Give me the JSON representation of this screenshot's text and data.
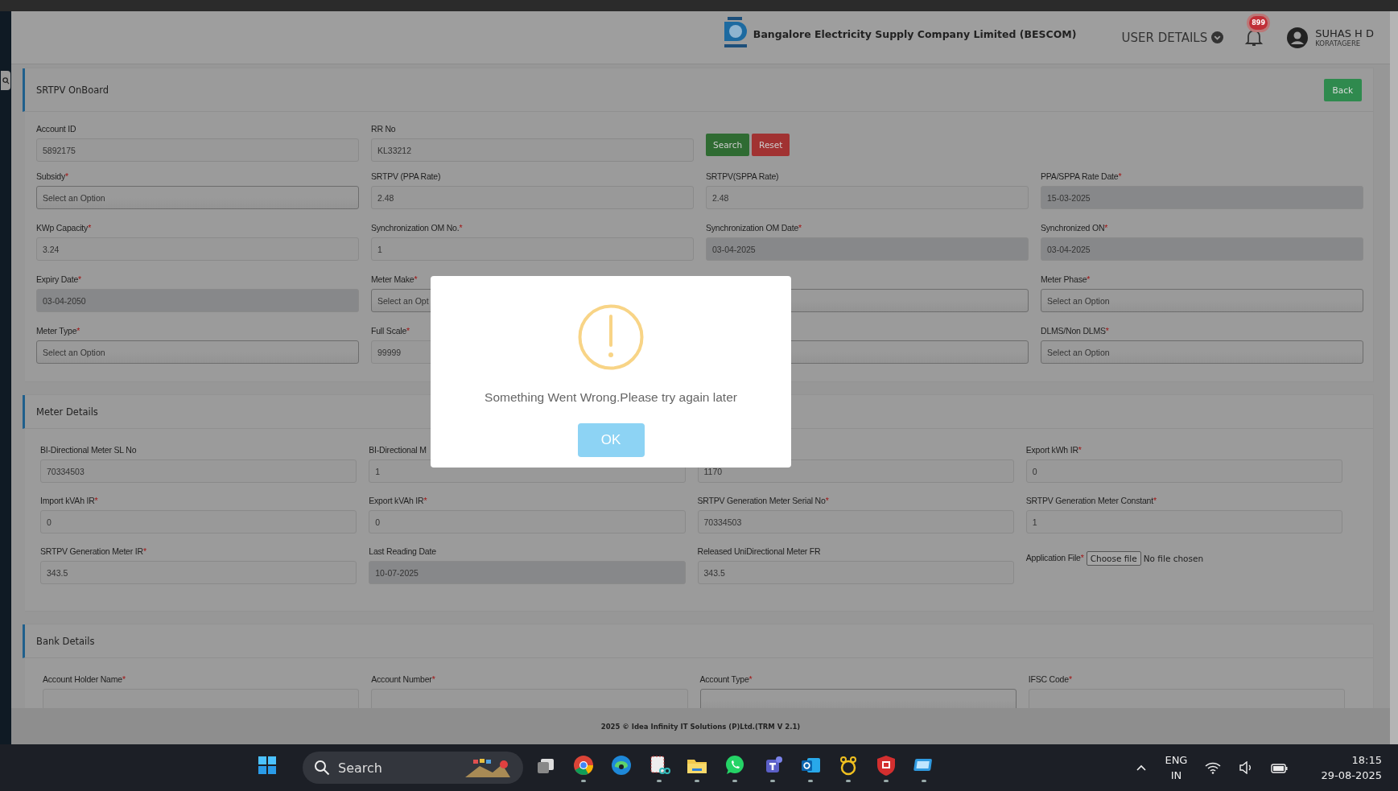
{
  "header": {
    "company": "Bangalore Electricity Supply Company Limited (BESCOM)",
    "user_menu": "USER DETAILS",
    "notifications": "899",
    "user_name": "SUHAS H D",
    "user_location": "KORATAGERE"
  },
  "page": {
    "title": "SRTPV OnBoard",
    "back": "Back"
  },
  "search_form": {
    "fields": [
      {
        "label": "Account ID",
        "kind": "text",
        "value": "5892175"
      },
      {
        "label": "RR No",
        "kind": "text",
        "value": "KL33212"
      }
    ],
    "buttons": [
      {
        "label": "Search",
        "kind": "primary"
      },
      {
        "label": "Reset",
        "kind": "danger"
      }
    ]
  },
  "details": {
    "fields": [
      {
        "label": "Subsidy",
        "required_mark": "*",
        "kind": "select",
        "placeholder": "Select an Option"
      },
      {
        "label": "SRTPV (PPA Rate)",
        "kind": "text",
        "value": "2.48"
      },
      {
        "label": "SRTPV(SPPA Rate)",
        "kind": "text",
        "value": "2.48"
      },
      {
        "label": "PPA/SPPA Rate Date",
        "required_mark": "*",
        "kind": "date",
        "value": "15-03-2025"
      },
      {
        "label": "KWp Capacity",
        "required_mark": "*",
        "kind": "text",
        "value": "3.24"
      },
      {
        "label": "Synchronization OM No.",
        "required_mark": "*",
        "kind": "text",
        "value": "1"
      },
      {
        "label": "Synchronization OM Date",
        "required_mark": "*",
        "kind": "date",
        "value": "03-04-2025"
      },
      {
        "label": "Synchronized ON",
        "required_mark": "*",
        "kind": "date",
        "value": "03-04-2025"
      },
      {
        "label": "Expiry Date",
        "required_mark": "*",
        "kind": "date",
        "value": "03-04-2050"
      },
      {
        "label": "Meter Make",
        "required_mark": "*",
        "kind": "select",
        "placeholder": "Select an Opt"
      },
      {
        "kind": "select"
      },
      {
        "label": "Meter Phase",
        "required_mark": "*",
        "kind": "select",
        "placeholder": "Select an Option"
      },
      {
        "label": "Meter Type",
        "required_mark": "*",
        "kind": "select",
        "placeholder": "Select an Option"
      },
      {
        "label": "Full Scale",
        "required_mark": "*",
        "kind": "text",
        "value": "99999"
      },
      {
        "kind": "select"
      },
      {
        "label": "DLMS/Non DLMS",
        "required_mark": "*",
        "kind": "select",
        "placeholder": "Select an Option"
      }
    ]
  },
  "meter_details": {
    "title": "Meter Details",
    "fields": [
      {
        "label": "BI-Directional Meter SL No",
        "kind": "text",
        "value": "70334503"
      },
      {
        "label": "BI-Directional M",
        "kind": "text",
        "value": "1"
      },
      {
        "kind": "text",
        "value": "1170"
      },
      {
        "label": "Export kWh IR",
        "required_mark": "*",
        "kind": "text",
        "value": "0"
      },
      {
        "label": "Import kVAh IR",
        "required_mark": "*",
        "kind": "text",
        "value": "0"
      },
      {
        "label": "Export kVAh IR",
        "required_mark": "*",
        "kind": "text",
        "value": "0"
      },
      {
        "label": "SRTPV Generation Meter Serial No",
        "required_mark": "*",
        "kind": "text",
        "value": "70334503"
      },
      {
        "label": "SRTPV Generation Meter Constant",
        "required_mark": "*",
        "kind": "text",
        "value": "1"
      },
      {
        "label": "SRTPV Generation Meter IR",
        "required_mark": "*",
        "kind": "text",
        "value": "343.5"
      },
      {
        "label": "Last Reading Date",
        "kind": "date",
        "value": "10-07-2025"
      },
      {
        "label": "Released UniDirectional Meter FR",
        "kind": "text",
        "value": "343.5"
      },
      {
        "label": "Application File",
        "required_mark": "*",
        "kind": "file",
        "button": "Choose file",
        "status": "No file chosen"
      }
    ]
  },
  "bank_details": {
    "title": "Bank Details",
    "fields": [
      {
        "label": "Account Holder Name",
        "required_mark": "*",
        "kind": "text"
      },
      {
        "label": "Account Number",
        "required_mark": "*",
        "kind": "text"
      },
      {
        "label": "Account Type",
        "required_mark": "*",
        "kind": "select"
      },
      {
        "label": "IFSC Code",
        "required_mark": "*",
        "kind": "text"
      }
    ]
  },
  "footer": "2025 © Idea Infinity IT Solutions (P)Ltd.(TRM V 2.1)",
  "dialog": {
    "message": "Something Went Wrong.Please try again later",
    "button": "OK"
  },
  "taskbar": {
    "search": "Search",
    "language": "ENG",
    "region": "IN",
    "time": "18:15",
    "date": "29-08-2025"
  }
}
